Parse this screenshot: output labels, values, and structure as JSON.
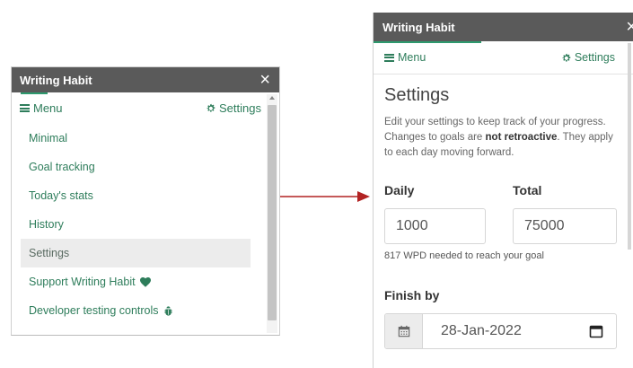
{
  "left_panel": {
    "title": "Writing Habit",
    "close": "×",
    "menu_label": "Menu",
    "settings_label": "Settings",
    "items": [
      {
        "label": "Minimal",
        "active": false
      },
      {
        "label": "Goal tracking",
        "active": false
      },
      {
        "label": "Today's stats",
        "active": false
      },
      {
        "label": "History",
        "active": false
      },
      {
        "label": "Settings",
        "active": true
      },
      {
        "label": "Support Writing Habit",
        "icon": "heart-icon"
      },
      {
        "label": "Developer testing controls",
        "icon": "bug-icon"
      }
    ]
  },
  "right_panel": {
    "title": "Writing Habit",
    "close": "×",
    "menu_label": "Menu",
    "settings_label": "Settings",
    "heading": "Settings",
    "desc_part1": "Edit your settings to keep track of your progress. Changes to goals are ",
    "desc_bold": "not retroactive",
    "desc_part2": ". They apply to each day moving forward.",
    "daily_label": "Daily",
    "daily_value": "1000",
    "total_label": "Total",
    "total_value": "75000",
    "hint": "817 WPD needed to reach your goal",
    "finish_label": "Finish by",
    "finish_value": "28-Jan-2022"
  },
  "colors": {
    "accent": "#2e7d5b",
    "titlebar": "#5a5a5a",
    "arrow": "#b22222"
  }
}
